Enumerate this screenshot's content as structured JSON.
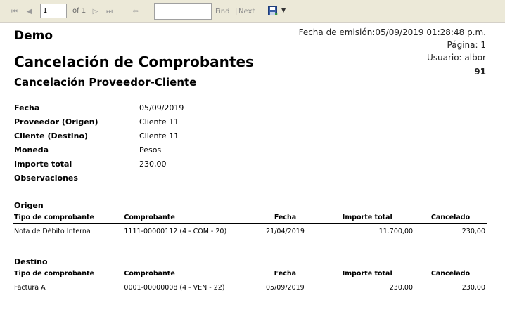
{
  "toolbar": {
    "page_value": "1",
    "of_label": "of 1",
    "find_label": "Find",
    "separator": "|",
    "next_label": "Next"
  },
  "report": {
    "company": "Demo",
    "title": "Cancelación de Comprobantes",
    "subtitle": "Cancelación Proveedor-Cliente",
    "emission": "Fecha de emisión:05/09/2019 01:28:48 p.m.",
    "page": "Página: 1",
    "user": "Usuario: albor",
    "number": "91",
    "fields": [
      {
        "label": "Fecha",
        "value": "05/09/2019"
      },
      {
        "label": "Proveedor (Origen)",
        "value": "Cliente 11"
      },
      {
        "label": "Cliente (Destino)",
        "value": "Cliente 11"
      },
      {
        "label": "Moneda",
        "value": "Pesos"
      },
      {
        "label": "Importe total",
        "value": "230,00"
      },
      {
        "label": "Observaciones",
        "value": ""
      }
    ],
    "columns": [
      "Tipo de comprobante",
      "Comprobante",
      "Fecha",
      "Importe total",
      "Cancelado"
    ],
    "origen": {
      "title": "Origen",
      "rows": [
        [
          "Nota de Débito Interna",
          "1111-00000112 (4 - COM - 20)",
          "21/04/2019",
          "11.700,00",
          "230,00"
        ]
      ]
    },
    "destino": {
      "title": "Destino",
      "rows": [
        [
          "Factura A",
          "0001-00000008 (4 - VEN - 22)",
          "05/09/2019",
          "230,00",
          "230,00"
        ]
      ]
    }
  }
}
